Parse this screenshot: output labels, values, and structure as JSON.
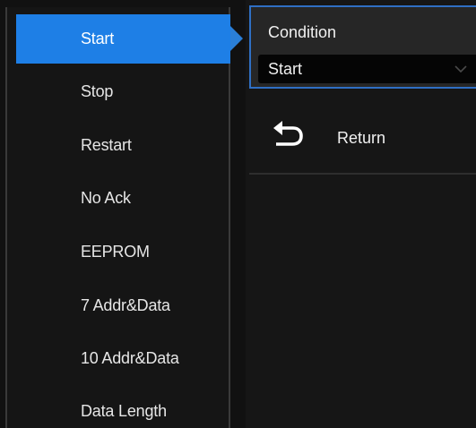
{
  "menu": {
    "items": [
      {
        "label": "Start",
        "selected": true
      },
      {
        "label": "Stop",
        "selected": false
      },
      {
        "label": "Restart",
        "selected": false
      },
      {
        "label": "No Ack",
        "selected": false
      },
      {
        "label": "EEPROM",
        "selected": false
      },
      {
        "label": "7 Addr&Data",
        "selected": false
      },
      {
        "label": "10 Addr&Data",
        "selected": false
      },
      {
        "label": "Data Length",
        "selected": false
      }
    ]
  },
  "condition": {
    "label": "Condition",
    "value": "Start"
  },
  "return": {
    "label": "Return",
    "icon": "return-arrow-icon"
  },
  "colors": {
    "accent": "#1e7fe6",
    "background": "#111111"
  }
}
